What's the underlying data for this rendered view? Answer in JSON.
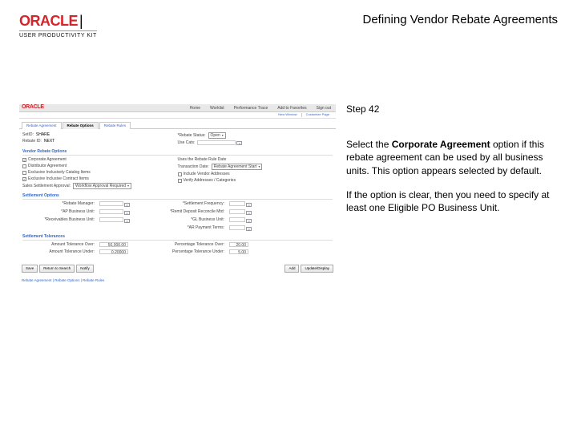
{
  "brand": {
    "logo": "ORACLE",
    "sub": "USER PRODUCTIVITY KIT"
  },
  "doc": {
    "title": "Defining Vendor Rebate Agreements"
  },
  "instructions": {
    "step": "Step 42",
    "p1a": "Select the ",
    "p1b": "Corporate Agreement",
    "p1c": " option if this rebate agreement can be used by all business units. This option appears selected by default.",
    "p2": "If the option is clear, then you need to specify at least one Eligible PO Business Unit."
  },
  "shot": {
    "topnav": [
      "Home",
      "Worklist",
      "Performance Trace",
      "Add to Favorites",
      "Sign out"
    ],
    "subnav": [
      "New Window",
      "Customize Page"
    ],
    "tabs": [
      "Rebate Agreement",
      "Rebate Options",
      "Rebate Rules"
    ],
    "active_tab": 1,
    "hdr": {
      "setid_l": "SetID:",
      "setid_v": "SHARE",
      "rebateid_l": "Rebate ID:",
      "rebateid_v": "NEXT",
      "status_l": "*Rebate Status:",
      "status_v": "Open",
      "usecats_l": "Use Cats:"
    },
    "sec_vendor": "Vendor Rebate Options",
    "vendor_opts": {
      "cb1": "Corporate Agreement",
      "cb2": "Distributor Agreement",
      "cb3": "Exclusive Inclusively Catalog Items",
      "cb4": "Exclusive Inclusive Contract Items",
      "r1": "Uses the Rebate Rule Date",
      "sel1_l": "Transaction Date:",
      "sel1_v": "Rebate Agreement Start",
      "cb5": "Include Vendor Addresses",
      "cb6": "Verify Addresses / Categories",
      "app_l": "Sales Settlement Approval:",
      "app_v": "Workflow Approval Required"
    },
    "sec_settle": "Settlement Options",
    "settle": {
      "mgr_l": "*Rebate Manager:",
      "mgr_v": "",
      "ap_l": "*AP Business Unit:",
      "ap_v": "",
      "rcv_l": "*Receivables Business Unit:",
      "rcv_v": "",
      "setf_l": "*Settlement Frequency:",
      "setf_v": "",
      "rtm_l": "*Remit Deposit Reconcile Mtd:",
      "rtm_v": "",
      "gl_l": "*GL Business Unit:",
      "gl_v": "",
      "pay_l": "*AR Payment Terms:",
      "pay_v": ""
    },
    "sec_tol": "Settlement Tolerances",
    "tol": {
      "over_l": "Amount Tolerance Over:",
      "over_v": "50,000.00",
      "under_l": "Amount Tolerance Under:",
      "under_v": "0.20000",
      "pover_l": "Percentage Tolerance Over:",
      "pover_v": "20.00",
      "punder_l": "Percentage Tolerance Under:",
      "punder_v": "5.00"
    },
    "buttons": {
      "save": "Save",
      "ret": "Return to Search",
      "notify": "Notify",
      "add": "Add",
      "upd": "Update/Display"
    },
    "breadcrumb": "Rebate Agreement | Rebate Options | Rebate Rules"
  }
}
